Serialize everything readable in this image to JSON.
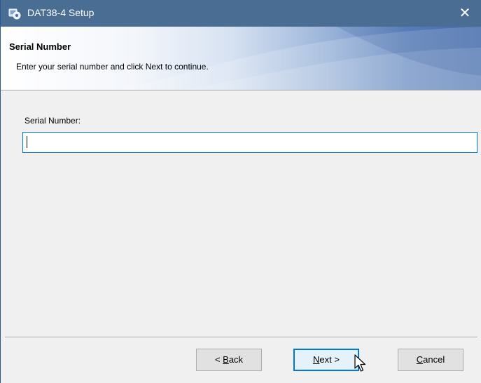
{
  "window": {
    "title": "DAT38-4 Setup",
    "close_glyph": "✕",
    "icons": {
      "app": "setup-app-icon",
      "close": "close-icon"
    }
  },
  "header": {
    "title": "Serial Number",
    "subtitle": "Enter your serial number and click Next to continue."
  },
  "form": {
    "serial_label": "Serial Number:",
    "serial_value": ""
  },
  "buttons": {
    "back": {
      "prefix": "< ",
      "mnemonic": "B",
      "rest": "ack"
    },
    "next": {
      "mnemonic": "N",
      "rest": "ext >"
    },
    "cancel": {
      "mnemonic": "C",
      "rest": "ancel"
    }
  },
  "colors": {
    "titlebar": "#4a6d94",
    "focus_accent": "#0078d7",
    "dialog_background": "#f0f0f0",
    "banner_gradient_end": "#4b72b1"
  }
}
